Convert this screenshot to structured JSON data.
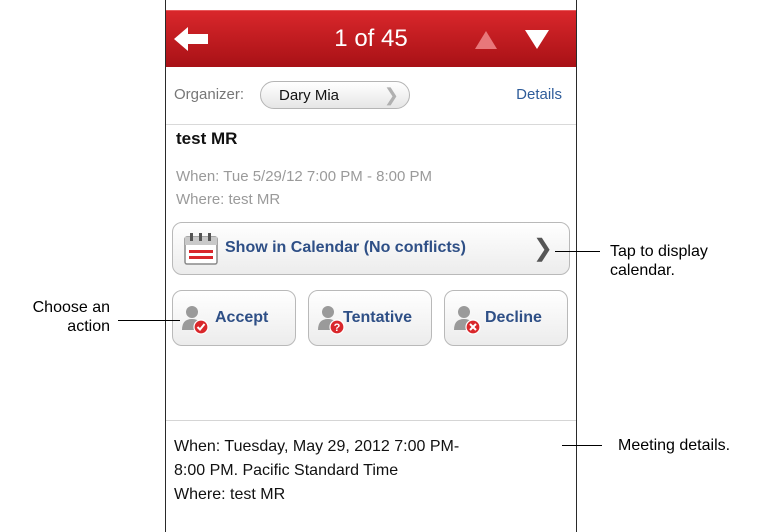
{
  "header": {
    "counter": "1 of 45"
  },
  "organizer": {
    "label": "Organizer:",
    "name": "Dary Mia",
    "details_link": "Details"
  },
  "meeting": {
    "subject": "test MR",
    "when": "When: Tue 5/29/12 7:00 PM - 8:00 PM",
    "where": "Where: test MR"
  },
  "calendar_button": {
    "label": "Show in Calendar (No conflicts)"
  },
  "actions": [
    {
      "label": "Accept",
      "status_color": "#d9272b"
    },
    {
      "label": "Tentative",
      "status_color": "#d9272b"
    },
    {
      "label": "Decline",
      "status_color": "#d9272b"
    }
  ],
  "details": {
    "line1": "When: Tuesday, May 29, 2012 7:00 PM-",
    "line2": "8:00 PM. Pacific Standard Time",
    "line3": "Where: test MR"
  },
  "callouts": {
    "calendar_line1": "Tap to display",
    "calendar_line2": "calendar.",
    "action_line1": "Choose an",
    "action_line2": "action",
    "details": "Meeting details."
  },
  "colors": {
    "header_red": "#c41a1f",
    "button_text": "#2e4f86",
    "link_blue": "#2e5c9a"
  },
  "icons": [
    "back-arrow-icon",
    "up-arrow-icon",
    "down-arrow-icon",
    "chevron-right-icon",
    "calendar-icon",
    "person-check-icon",
    "person-question-icon",
    "person-x-icon"
  ]
}
